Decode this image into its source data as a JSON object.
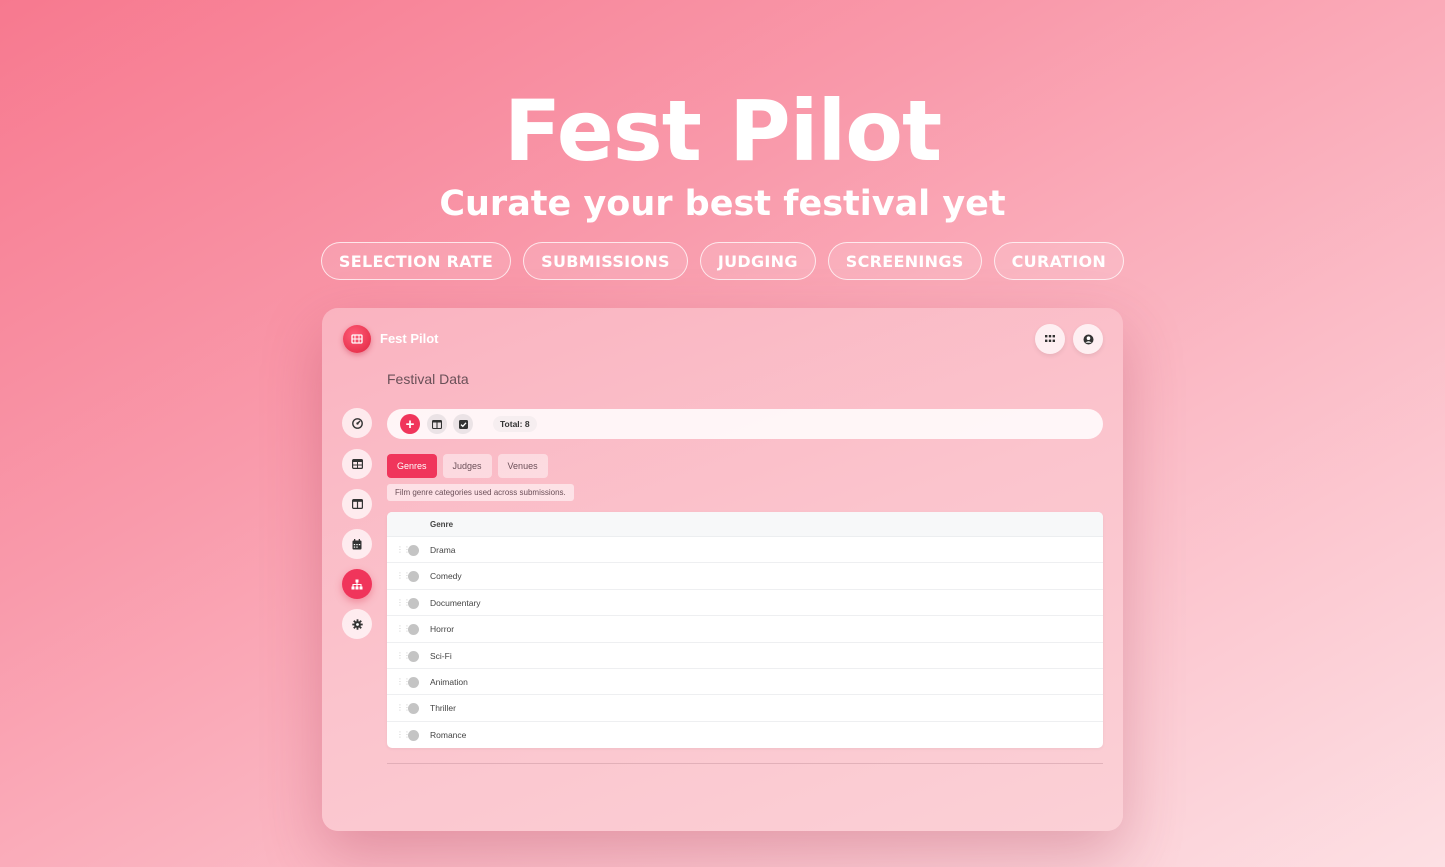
{
  "hero": {
    "title": "Fest Pilot",
    "subtitle": "Curate your best festival yet",
    "pills": [
      "SELECTION RATE",
      "SUBMISSIONS",
      "JUDGING",
      "SCREENINGS",
      "CURATION"
    ]
  },
  "app": {
    "name": "Fest Pilot",
    "logo_icon": "film-icon",
    "top_actions": [
      "apps-grid-icon",
      "user-circle-icon"
    ]
  },
  "page": {
    "title": "Festival Data"
  },
  "sidebar": {
    "items": [
      {
        "icon": "dashboard-icon",
        "active": false
      },
      {
        "icon": "table-icon",
        "active": false
      },
      {
        "icon": "columns-icon",
        "active": false
      },
      {
        "icon": "calendar-icon",
        "active": false
      },
      {
        "icon": "hierarchy-icon",
        "active": true
      },
      {
        "icon": "gear-icon",
        "active": false
      }
    ]
  },
  "toolbar": {
    "add_label": "+",
    "total_label": "Total:",
    "total_value": "8"
  },
  "tabs": [
    "Genres",
    "Judges",
    "Venues"
  ],
  "active_tab": "Genres",
  "description": "Film genre categories used across submissions.",
  "table": {
    "header": "Genre",
    "rows": [
      "Drama",
      "Comedy",
      "Documentary",
      "Horror",
      "Sci-Fi",
      "Animation",
      "Thriller",
      "Romance"
    ]
  },
  "colors": {
    "accent": "#f0355b",
    "background_start": "#f7798f",
    "background_end": "#fde0e4"
  }
}
